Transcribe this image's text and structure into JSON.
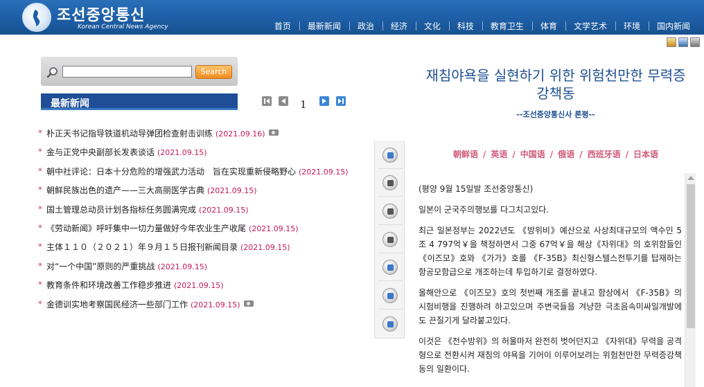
{
  "header": {
    "logo_text": "조선중앙통신",
    "logo_subtext": "Korean Central News Agency",
    "nav": [
      "首页",
      "最新新闻",
      "政治",
      "经济",
      "文化",
      "科技",
      "教育卫生",
      "体育",
      "文学艺术",
      "环境",
      "国内新闻"
    ]
  },
  "search": {
    "placeholder": "",
    "button_label": "Search"
  },
  "latest": {
    "title": "最新新闻",
    "page_number": "1",
    "items": [
      {
        "text": "朴正天书记指导铁道机动导弹团检查射击训练",
        "date": "(2021.09.16)",
        "photo": true
      },
      {
        "text": "金与正党中央副部长发表谈话",
        "date": "(2021.09.15)",
        "photo": false
      },
      {
        "text": "朝中社评论：日本十分危险的增强武力活动　旨在实现重新侵略野心",
        "date": "(2021.09.15)",
        "photo": false
      },
      {
        "text": "朝鲜民族出色的遗产——三大高丽医学古典",
        "date": "(2021.09.15)",
        "photo": false
      },
      {
        "text": "国土管理总动员计划各指标任务圆满完成",
        "date": "(2021.09.15)",
        "photo": false
      },
      {
        "text": "《劳动新闻》呼吁集中一切力量做好今年农业生产收尾",
        "date": "(2021.09.15)",
        "photo": false
      },
      {
        "text": "主体１１０（２０２１）年９月１５日报刊新闻目录",
        "date": "(2021.09.15)",
        "photo": false
      },
      {
        "text": "对“一个中国”原则的严重挑战",
        "date": "(2021.09.15)",
        "photo": false
      },
      {
        "text": "教育条件和环境改善工作稳步推进",
        "date": "(2021.09.15)",
        "photo": false
      },
      {
        "text": "金德训实地考察国民经济一些部门工作",
        "date": "(2021.09.15)",
        "photo": true
      }
    ]
  },
  "article": {
    "title": "재침야욕을 실현하기 위한 위험천만한 무력증강책동",
    "source": "--조선중앙통신사 론평--",
    "languages": [
      "朝鲜语",
      "英语",
      "中国语",
      "俄语",
      "西班牙语",
      "日本语"
    ],
    "paragraphs": [
      "(평양 9월 15일발 조선중앙통신)",
      "일본이 군국주의행보를 다그치고있다.",
      "최근 일본정부는 2022년도 《방위비》예산으로 사상최대규모의 액수인 5조 4 797억￥을 책정하면서 그중 67억￥을 해상《자위대》의 호위함들인 《이즈모》호와 《가가》호를 《F-35B》최신형스텔스전투기를 탑재하는 항공모함급으로 개조하는데 투입하기로 결정하였다.",
      "올해안으로 《이즈모》호의 첫번째 개조를 끝내고 함상에서 《F-35B》의 시험비행을 진행하려 하고있으며 주변국들을 겨냥한 극초음속미싸일개발에도 끈질기게 달라붙고있다.",
      "이것은 《전수방위》의 허울마저 완전히 벗어던지고 《자위대》무력을 공격형으로 전환시켜 재침의 야욕을 기어이 이루어보려는 위험천만한 무력증강책동의 일환이다."
    ]
  },
  "colors": {
    "header_blue": "#1d5ea6",
    "title_blue": "#1d4f93",
    "date_magenta": "#c2185b",
    "search_orange": "#f08c20"
  }
}
